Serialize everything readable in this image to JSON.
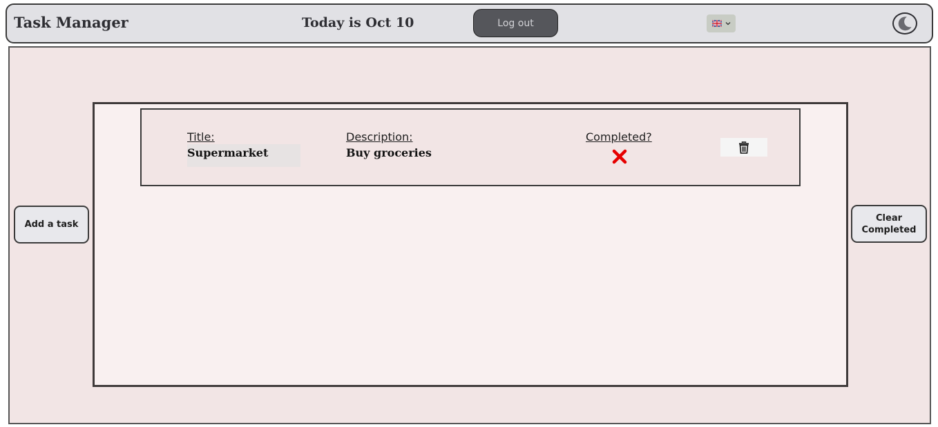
{
  "header": {
    "app_title": "Task Manager",
    "date_text": "Today is Oct 10",
    "logout_label": "Log out",
    "language": {
      "selected": "en-GB",
      "icon": "uk-flag-icon"
    },
    "theme_icon": "moon-icon"
  },
  "actions": {
    "add_task_label": "Add a task",
    "clear_completed_label": "Clear Completed"
  },
  "tasks": [
    {
      "title_label": "Title:",
      "title": "Supermarket",
      "description_label": "Description:",
      "description": "Buy groceries",
      "completed_label": "Completed?",
      "completed": false,
      "completed_icon": "x-mark-icon",
      "delete_icon": "trash-icon"
    }
  ],
  "colors": {
    "background": "#f2e5e5",
    "panel": "#f9f0f0",
    "header": "#e1e1e5",
    "logout_button": "#55565b",
    "incomplete_mark": "#e60000"
  }
}
